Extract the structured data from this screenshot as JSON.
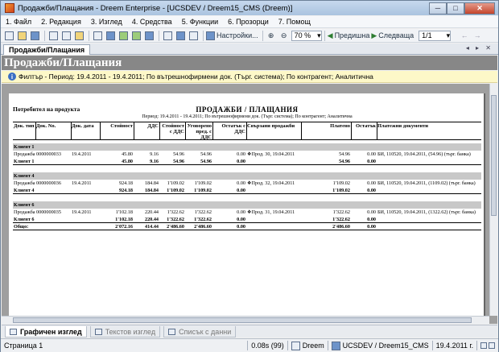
{
  "window": {
    "title": "Продажби/Плащания - Dreem Enterprise - [UCSDEV / Dreem15_CMS (Dreem)]",
    "min": "─",
    "max": "□",
    "close": "✕"
  },
  "menu": [
    "1. Файл",
    "2. Редакция",
    "3. Изглед",
    "4. Средства",
    "5. Функции",
    "6. Прозорци",
    "7. Помощ"
  ],
  "toolbar": {
    "settings": "Настройки...",
    "zoom": "70 %",
    "prev": "Предишна",
    "next": "Следваща",
    "page": "1/1"
  },
  "doc_tab": "Продажби/Плащания",
  "tab_nav": "◂ ▸ ✕",
  "banner": "Продажби/Плащания",
  "filter": "Филтър - Период: 19.4.2011 - 19.4.2011; По вътрешнофирмени док. (Търг. система); По контрагент; Аналитична",
  "report": {
    "group_label": "Потребител на продукта",
    "title": "ПРОДАЖБИ / ПЛАЩАНИЯ",
    "subtitle": "Период: 19.4.2011 - 19.4.2011; По вътрешнофирмени док. (Търг. система); По контрагент; Аналитична",
    "columns": [
      "Док. тип",
      "Док. No.",
      "Док. дата",
      "Стойност",
      "ДДС",
      "Стойност с ДДС",
      "Уговорено пред. с ДДС",
      "Остатък с ДДС",
      "Свързани продажби",
      "Платено",
      "Остатък",
      "Платежни документи"
    ],
    "groups": [
      {
        "name": "Клиент 1",
        "rows": [
          [
            "Продажба",
            "0000000033",
            "19.4.2011",
            "45.80",
            "9.16",
            "54.96",
            "54.96",
            "0.00",
            "❖Прод. 30, 19.04.2011",
            "54.96",
            "0.00",
            "БИ, 110520, 19.04.2011, (54.96) (търг. банка)"
          ]
        ],
        "total": [
          "Клиент 1",
          "",
          "",
          "45.80",
          "9.16",
          "54.96",
          "54.96",
          "0.00",
          "",
          "54.96",
          "0.00",
          ""
        ]
      },
      {
        "name": "Клиент 4",
        "rows": [
          [
            "Продажба",
            "0000000036",
            "19.4.2011",
            "924.18",
            "184.84",
            "1'109.02",
            "1'109.02",
            "0.00",
            "❖Прод. 32, 19.04.2011",
            "1'109.02",
            "0.00",
            "БИ, 110520, 19.04.2011, (1109.02) (търг. банка)"
          ]
        ],
        "total": [
          "Клиент 4",
          "",
          "",
          "924.18",
          "184.84",
          "1'109.02",
          "1'109.02",
          "0.00",
          "",
          "1'109.02",
          "0.00",
          ""
        ]
      },
      {
        "name": "Клиент 6",
        "rows": [
          [
            "Продажба",
            "0000000035",
            "19.4.2011",
            "1'102.18",
            "220.44",
            "1'322.62",
            "1'322.62",
            "0.00",
            "❖Прод. 31, 19.04.2011",
            "1'322.62",
            "0.00",
            "БИ, 110520, 19.04.2011, (1322.62) (търг. банка)"
          ]
        ],
        "total": [
          "Клиент 6",
          "",
          "",
          "1'102.18",
          "220.44",
          "1'322.62",
          "1'322.62",
          "0.00",
          "",
          "1'322.62",
          "0.00",
          ""
        ]
      }
    ],
    "grand_total": [
      "Общо:",
      "",
      "",
      "2'072.16",
      "414.44",
      "2'486.60",
      "2'486.60",
      "0.00",
      "",
      "2'486.60",
      "0.00",
      ""
    ]
  },
  "view_tabs": [
    "Графичен изглед",
    "Текстов изглед",
    "Списък с данни"
  ],
  "status": {
    "page": "Страница 1",
    "time": "0.08s (99)",
    "app": "Dreem",
    "db": "UCSDEV / Dreem15_CMS",
    "date": "19.4.2011 г."
  }
}
